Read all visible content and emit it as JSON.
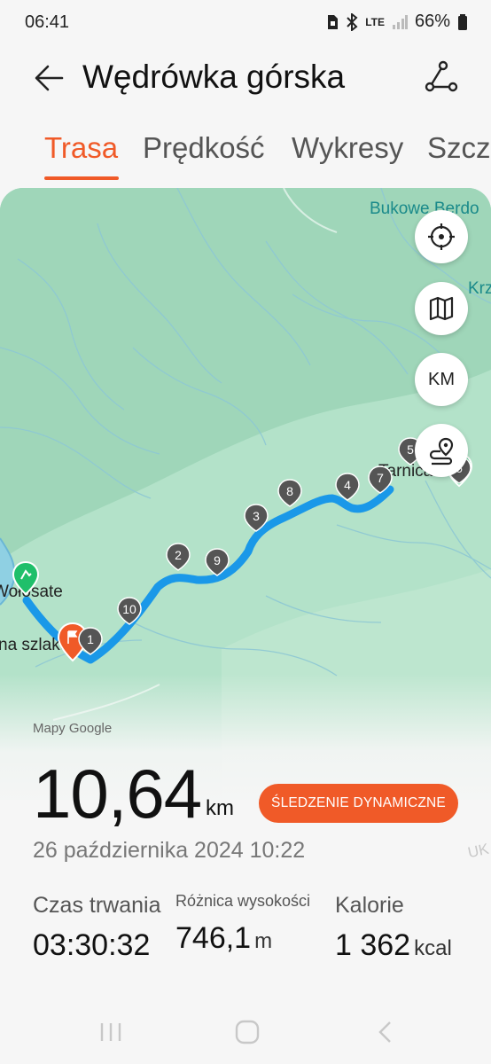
{
  "status": {
    "time": "06:41",
    "network": "LTE",
    "battery": "66%"
  },
  "header": {
    "title": "Wędrówka górska"
  },
  "tabs": [
    {
      "label": "Trasa",
      "active": true
    },
    {
      "label": "Prędkość",
      "active": false
    },
    {
      "label": "Wykresy",
      "active": false
    },
    {
      "label": "Szcz",
      "active": false
    }
  ],
  "map": {
    "places": {
      "top_right": "Bukowe Berdo",
      "right_edge": "Krz",
      "tarnica": "Tarnica",
      "wolosate": "Wołosate",
      "trail": "na szlaku"
    },
    "controls": {
      "km_label": "KM"
    },
    "markers": [
      "1",
      "2",
      "3",
      "4",
      "5",
      "6",
      "7",
      "8",
      "9",
      "10"
    ],
    "attribution": "Mapy Google",
    "faded_text": "UK"
  },
  "summary": {
    "distance": "10,64",
    "distance_unit": "km",
    "dynamic_button": "ŚLEDZENIE DYNAMICZNE",
    "date": "26 października 2024 10:22"
  },
  "stats": {
    "duration_label": "Czas trwania",
    "duration_value": "03:30:32",
    "elevation_label": "Różnica wysokości",
    "elevation_value": "746,1",
    "elevation_unit": "m",
    "calories_label": "Kalorie",
    "calories_value": "1 362",
    "calories_unit": "kcal"
  }
}
